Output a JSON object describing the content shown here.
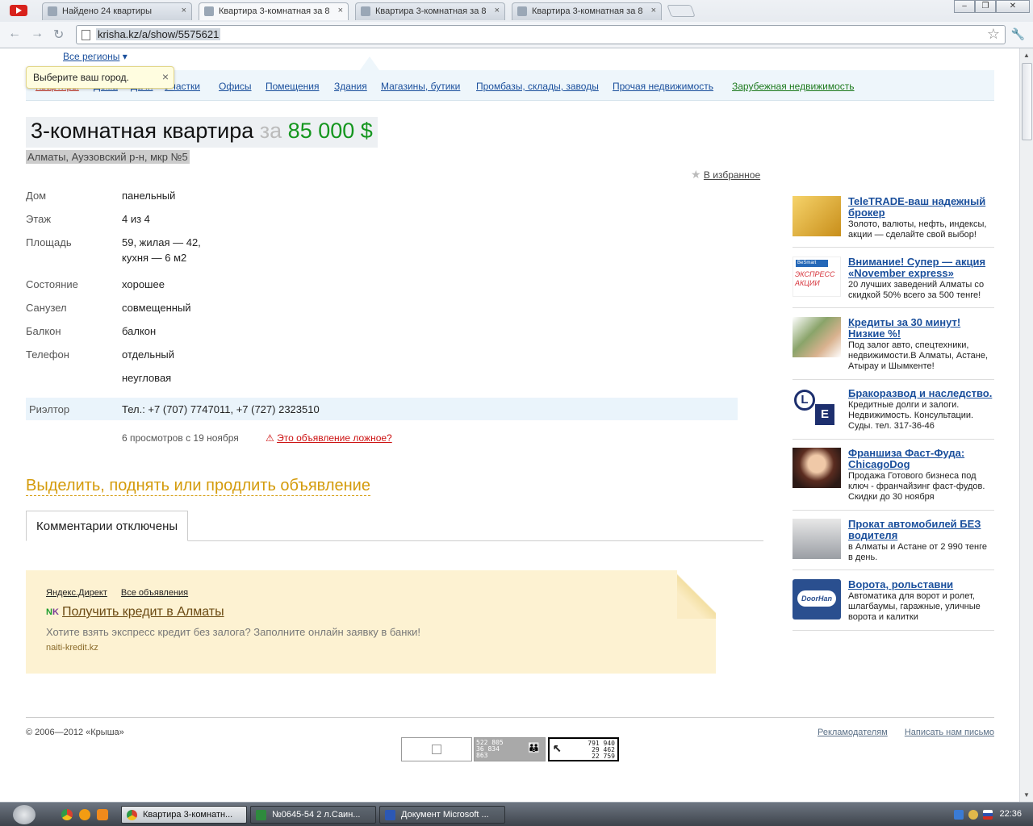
{
  "browser": {
    "tabs": [
      {
        "label": "Найдено 24 квартиры",
        "active": false
      },
      {
        "label": "Квартира 3-комнатная за 8",
        "active": true
      },
      {
        "label": "Квартира 3-комнатная за 8",
        "active": false
      },
      {
        "label": "Квартира 3-комнатная за 8",
        "active": false
      }
    ],
    "url": "krisha.kz/a/show/5575621",
    "tab_close": "×",
    "back": "←",
    "forward": "→",
    "reload": "↻",
    "star": "☆",
    "wrench": "🔧",
    "min": "‒",
    "max": "❐",
    "close": "✕"
  },
  "header": {
    "regions_link": "Все регионы",
    "regions_arrow": "▾",
    "tooltip_text": "Выберите ваш город.",
    "tooltip_close": "×"
  },
  "nav": {
    "items": [
      {
        "label": "Квартиры"
      },
      {
        "label": "Дома"
      },
      {
        "label": "Дачи"
      },
      {
        "label": "Участки"
      },
      {
        "label": "Офисы"
      },
      {
        "label": "Помещения"
      },
      {
        "label": "Здания"
      },
      {
        "label": "Магазины, бутики"
      },
      {
        "label": "Промбазы, склады, заводы"
      },
      {
        "label": "Прочая недвижимость"
      },
      {
        "label": "Зарубежная недвижимость"
      }
    ]
  },
  "listing": {
    "title": "3-комнатная квартира",
    "price_prefix": "за",
    "price": "85 000 $",
    "address": "Алматы, Ауэзовский р-н, мкр №5",
    "favorite_label": "В избранное",
    "favorite_icon": "★",
    "properties": [
      {
        "label": "Дом",
        "value": "панельный"
      },
      {
        "label": "Этаж",
        "value": "4 из 4"
      },
      {
        "label": "Площадь",
        "value": "59, жилая — 42,",
        "value2": "кухня — 6 м2"
      },
      {
        "label": "Состояние",
        "value": "хорошее"
      },
      {
        "label": "Санузел",
        "value": "совмещенный"
      },
      {
        "label": "Балкон",
        "value": "балкон"
      },
      {
        "label": "Телефон",
        "value": "отдельный"
      },
      {
        "label": "",
        "value": "неугловая"
      }
    ],
    "realtor_label": "Риэлтор",
    "realtor_value": "Тел.: +7 (707) 7747011, +7 (727) 2323510",
    "views": "6 просмотров с 19 ноября",
    "report_icon": "⚠",
    "report": "Это объявление ложное?",
    "promote": "Выделить, поднять или продлить объявление",
    "comments_tab": "Комментарии отключены"
  },
  "direct": {
    "link1": "Яндекс.Директ",
    "link2": "Все объявления",
    "nk_n": "N",
    "nk_k": "K",
    "title": "Получить кредит в Алматы",
    "text": "Хотите взять экспресс кредит без залога? Заполните онлайн заявку в банки!",
    "url": "naiti-kredit.kz"
  },
  "ads": [
    {
      "title": "TeleTRADE-ваш надежный брокер",
      "desc": "Золото, валюты, нефть, индексы, акции — сделайте свой выбор!",
      "color": "#e6b93a"
    },
    {
      "title": "Внимание! Супер — акция «November express»",
      "desc": "20 лучших заведений Алматы со скидкой 50% всего за 500 тенге!",
      "color": "#d6343c",
      "img_top": "BeSmart",
      "img_text": "ЭКСПРЕСС АКЦИИ"
    },
    {
      "title": "Кредиты за 30 минут! Низкие %!",
      "desc": "Под залог авто, спецтехники, недвижимости.В Алматы, Астане, Атырау и Шымкенте!",
      "color": "#6b8a4a"
    },
    {
      "title": "Бракоразвод и наследство.",
      "desc": "Кредитные долги и залоги. Недвижимость. Консультации. Суды. тел. 317-36-46",
      "color": "#1d2f6e",
      "img_l1": "L",
      "img_l2": "E"
    },
    {
      "title": "Франшиза Фаст-Фуда: ChicagoDog",
      "desc": "Продажа Готового бизнеса под ключ - франчайзинг фаст-фудов. Скидки до 30 ноября",
      "color": "#b0544a"
    },
    {
      "title": "Прокат автомобилей БЕЗ водителя",
      "desc": "в Алматы и Астане от 2 990 тенге в день.",
      "color": "#8a8f96"
    },
    {
      "title": "Ворота, рольставни",
      "desc": "Автоматика для ворот и ролет, шлагбаумы, гаражные, уличные ворота и калитки",
      "color": "#2a4f8f",
      "img_text": "DoorHan"
    }
  ],
  "footer": {
    "copyright": "© 2006—2012 «Крыша»",
    "advertisers": "Рекламодателям",
    "write_us": "Написать нам письмо",
    "counter2_l1": "522 805",
    "counter2_l2": "36 834",
    "counter2_l3": "863",
    "counter3_l1": "791 940",
    "counter3_l2": "29 462",
    "counter3_l3": "22 759",
    "counter3_arrow": "↖"
  },
  "taskbar": {
    "tasks": [
      {
        "label": "Квартира 3-комнатн...",
        "active": true,
        "color": "#d9412f"
      },
      {
        "label": "№0645-54 2 л.Саин...",
        "active": false,
        "color": "#2e8b3d"
      },
      {
        "label": "Документ Microsoft ...",
        "active": false,
        "color": "#2c58b4"
      }
    ],
    "clock": "22:36"
  }
}
